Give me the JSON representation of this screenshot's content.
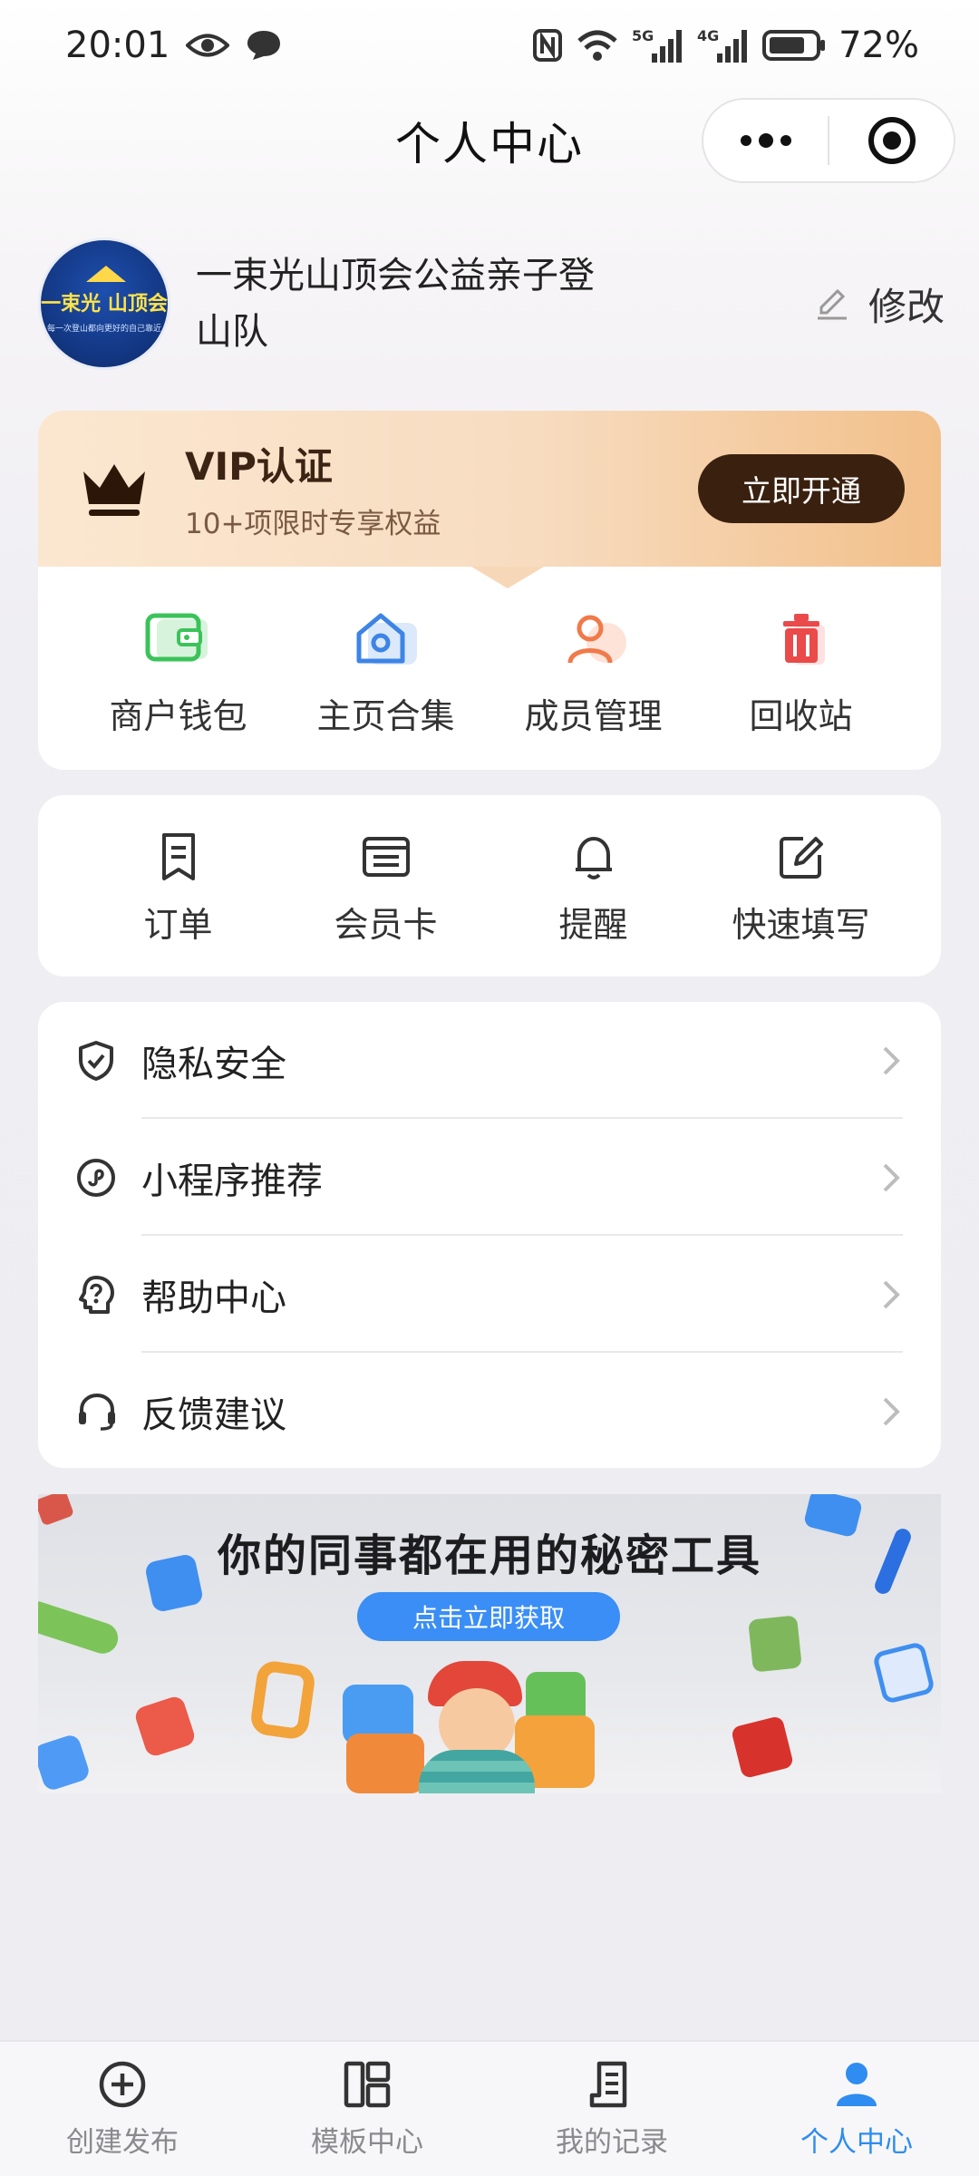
{
  "status_bar": {
    "time": "20:01",
    "battery": "72%",
    "net1": "5G",
    "net2": "4G"
  },
  "nav": {
    "title": "个人中心",
    "more_icon": "more-dots-icon",
    "target_icon": "target-circle-icon"
  },
  "profile": {
    "name": "一束光山顶会公益亲子登山队",
    "avatar_text": "一束光 山顶会",
    "avatar_subtext": "每一次登山都向更好的自己靠近",
    "edit_label": "修改"
  },
  "vip": {
    "title": "VIP认证",
    "subtitle": "10+项限时专享权益",
    "button": "立即开通",
    "colors": {
      "button": "#3a200f",
      "gradient_end": "#f2c08a"
    }
  },
  "quick_grid": [
    {
      "label": "商户钱包",
      "icon": "wallet-icon"
    },
    {
      "label": "主页合集",
      "icon": "home-collection-icon"
    },
    {
      "label": "成员管理",
      "icon": "member-icon"
    },
    {
      "label": "回收站",
      "icon": "trash-icon"
    }
  ],
  "tools_grid": [
    {
      "label": "订单",
      "icon": "order-icon"
    },
    {
      "label": "会员卡",
      "icon": "member-card-icon"
    },
    {
      "label": "提醒",
      "icon": "bell-icon"
    },
    {
      "label": "快速填写",
      "icon": "quick-edit-icon"
    }
  ],
  "menu": [
    {
      "label": "隐私安全",
      "icon": "shield-icon"
    },
    {
      "label": "小程序推荐",
      "icon": "mini-program-icon"
    },
    {
      "label": "帮助中心",
      "icon": "help-icon"
    },
    {
      "label": "反馈建议",
      "icon": "headset-icon"
    }
  ],
  "banner": {
    "title": "你的同事都在用的秘密工具",
    "button": "点击立即获取"
  },
  "tabbar": [
    {
      "label": "创建发布",
      "icon": "plus-circle-icon"
    },
    {
      "label": "模板中心",
      "icon": "template-icon"
    },
    {
      "label": "我的记录",
      "icon": "record-icon"
    },
    {
      "label": "个人中心",
      "icon": "person-icon",
      "active": true
    }
  ],
  "colors": {
    "accent": "#2f8cf0"
  }
}
